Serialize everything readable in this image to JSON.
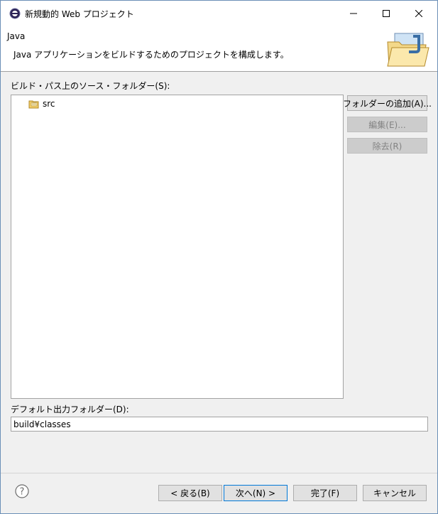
{
  "window": {
    "title": "新規動的 Web プロジェクト"
  },
  "header": {
    "title": "Java",
    "description": "Java アプリケーションをビルドするためのプロジェクトを構成します。"
  },
  "source": {
    "label": "ビルド・パス上のソース・フォルダー(S):",
    "items": [
      "src"
    ]
  },
  "buttons": {
    "add_folder": "フォルダーの追加(A)...",
    "edit": "編集(E)...",
    "remove": "除去(R)"
  },
  "output": {
    "label": "デフォルト出力フォルダー(D):",
    "value": "build¥classes"
  },
  "footer": {
    "back": "< 戻る(B)",
    "next": "次へ(N) >",
    "finish": "完了(F)",
    "cancel": "キャンセル"
  }
}
